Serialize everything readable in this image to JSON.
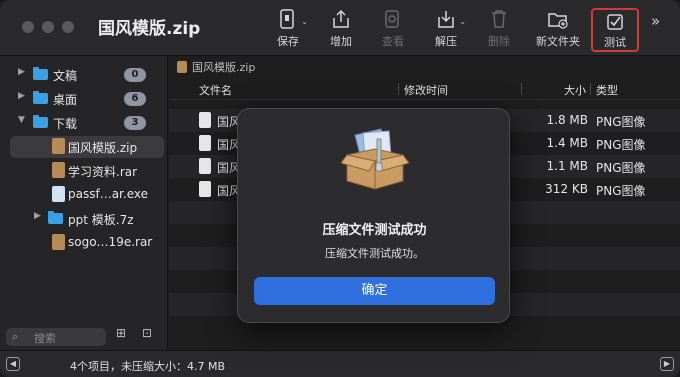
{
  "window": {
    "title": "国风模版.zip"
  },
  "toolbar": {
    "save": "保存",
    "add": "增加",
    "view": "查看",
    "extract": "解压",
    "delete": "删除",
    "new_folder": "新文件夹",
    "test": "测试",
    "overflow": "»"
  },
  "sidebar": {
    "items": [
      {
        "label": "文稿",
        "badge": "0"
      },
      {
        "label": "桌面",
        "badge": "6"
      },
      {
        "label": "下载",
        "badge": "3"
      },
      {
        "label": "国风模版.zip"
      },
      {
        "label": "学习资料.rar"
      },
      {
        "label": "passf…ar.exe"
      },
      {
        "label": "ppt 模板.7z"
      },
      {
        "label": "sogo…19e.rar"
      }
    ],
    "search_placeholder": "搜索"
  },
  "main": {
    "path": "国风模版.zip",
    "columns": {
      "name": "文件名",
      "modified": "修改时间",
      "size": "大小",
      "type": "类型"
    },
    "rows": [
      {
        "name": "国风",
        "size": "1.8 MB",
        "type": "PNG图像"
      },
      {
        "name": "国风",
        "size": "1.4 MB",
        "type": "PNG图像"
      },
      {
        "name": "国风",
        "size": "1.1 MB",
        "type": "PNG图像"
      },
      {
        "name": "国风",
        "size": "312 KB",
        "type": "PNG图像"
      }
    ]
  },
  "status": {
    "text": "4个项目，未压缩大小：4.7 MB"
  },
  "dialog": {
    "title": "压缩文件测试成功",
    "message": "压缩文件测试成功。",
    "ok": "确定"
  }
}
